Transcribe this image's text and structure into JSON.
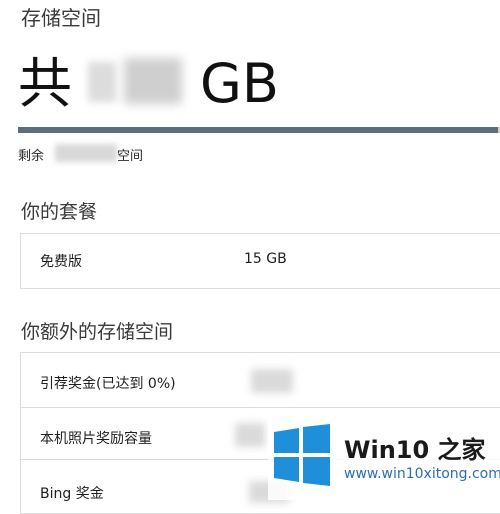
{
  "page": {
    "title": "存储空间",
    "total_prefix": "共",
    "total_unit": "GB",
    "usage_fraction": 0.995,
    "remaining_prefix": "剩余",
    "remaining_suffix": "空间"
  },
  "plan": {
    "heading": "你的套餐",
    "rows": [
      {
        "label": "免费版",
        "value": "15 GB"
      }
    ]
  },
  "extra": {
    "heading": "你额外的存储空间",
    "rows": [
      {
        "label": "引荐奖金(已达到 0%)"
      },
      {
        "label": "本机照片奖励容量"
      },
      {
        "label": "Bing 奖金"
      }
    ]
  },
  "watermark": {
    "title": "Win10 之家",
    "url": "www.win10xitong.com",
    "icon": "windows-logo-icon",
    "colors": {
      "logo_blue": "#1e8fd8"
    }
  }
}
